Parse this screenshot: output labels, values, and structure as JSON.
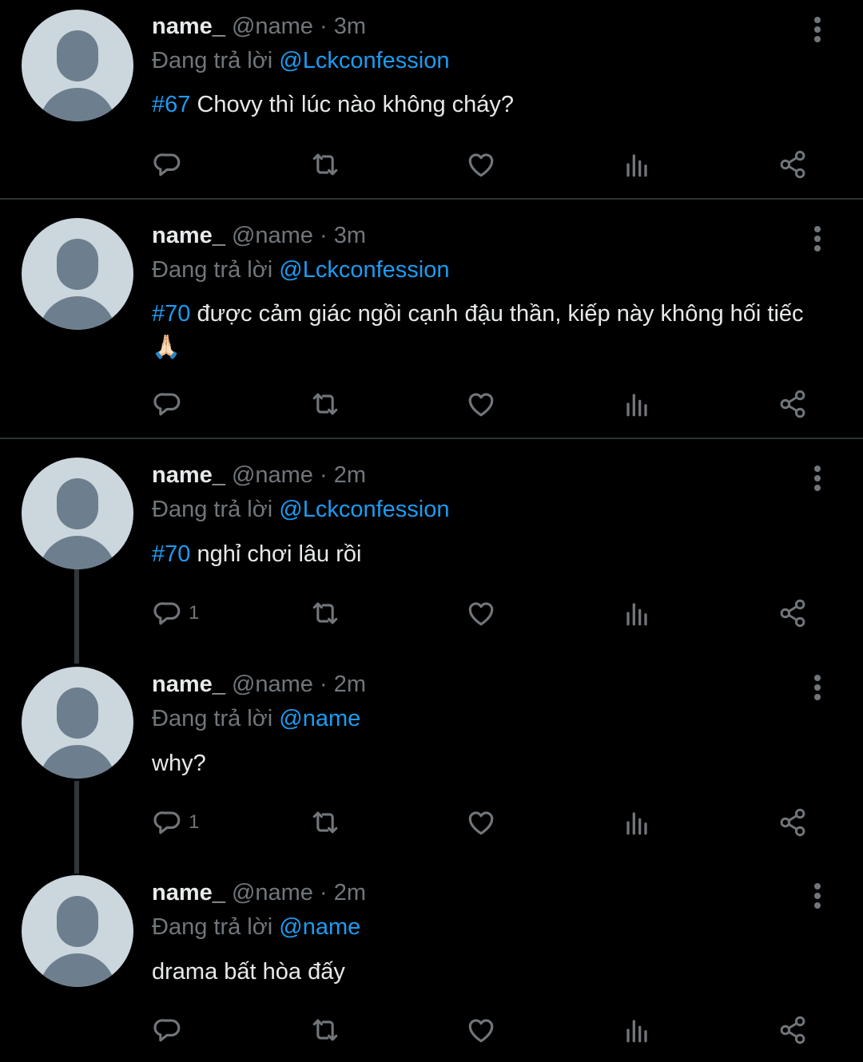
{
  "colors": {
    "background": "#000000",
    "accent": "#1d9bf0",
    "muted": "#71767b",
    "text": "#e7e9ea",
    "divider": "#2f3336"
  },
  "icons": [
    "reply-icon",
    "retweet-icon",
    "like-icon",
    "views-icon",
    "share-icon",
    "more-icon",
    "avatar-placeholder"
  ],
  "tweets": [
    {
      "display_name": "name_",
      "handle": "@name",
      "separator": "·",
      "time": "3m",
      "replying_prefix": "Đang trả lời",
      "replying_to": "@Lckconfession",
      "hashtag": "#67",
      "text": " Chovy thì lúc nào không cháy?",
      "emoji": "",
      "reply_count": ""
    },
    {
      "display_name": "name_",
      "handle": "@name",
      "separator": "·",
      "time": "3m",
      "replying_prefix": "Đang trả lời",
      "replying_to": "@Lckconfession",
      "hashtag": "#70",
      "text": " được cảm giác ngồi cạnh đậu thần, kiếp này không hối tiếc",
      "emoji": "🙏🏻",
      "reply_count": ""
    },
    {
      "display_name": "name_",
      "handle": "@name",
      "separator": "·",
      "time": "2m",
      "replying_prefix": "Đang trả lời",
      "replying_to": "@Lckconfession",
      "hashtag": "#70",
      "text": " nghỉ chơi lâu rồi",
      "emoji": "",
      "reply_count": "1"
    },
    {
      "display_name": "name_",
      "handle": "@name",
      "separator": "·",
      "time": "2m",
      "replying_prefix": "Đang trả lời",
      "replying_to": "@name",
      "hashtag": "",
      "text": "why?",
      "emoji": "",
      "reply_count": "1"
    },
    {
      "display_name": "name_",
      "handle": "@name",
      "separator": "·",
      "time": "2m",
      "replying_prefix": "Đang trả lời",
      "replying_to": "@name",
      "hashtag": "",
      "text": "drama bất hòa đấy",
      "emoji": "",
      "reply_count": ""
    }
  ]
}
